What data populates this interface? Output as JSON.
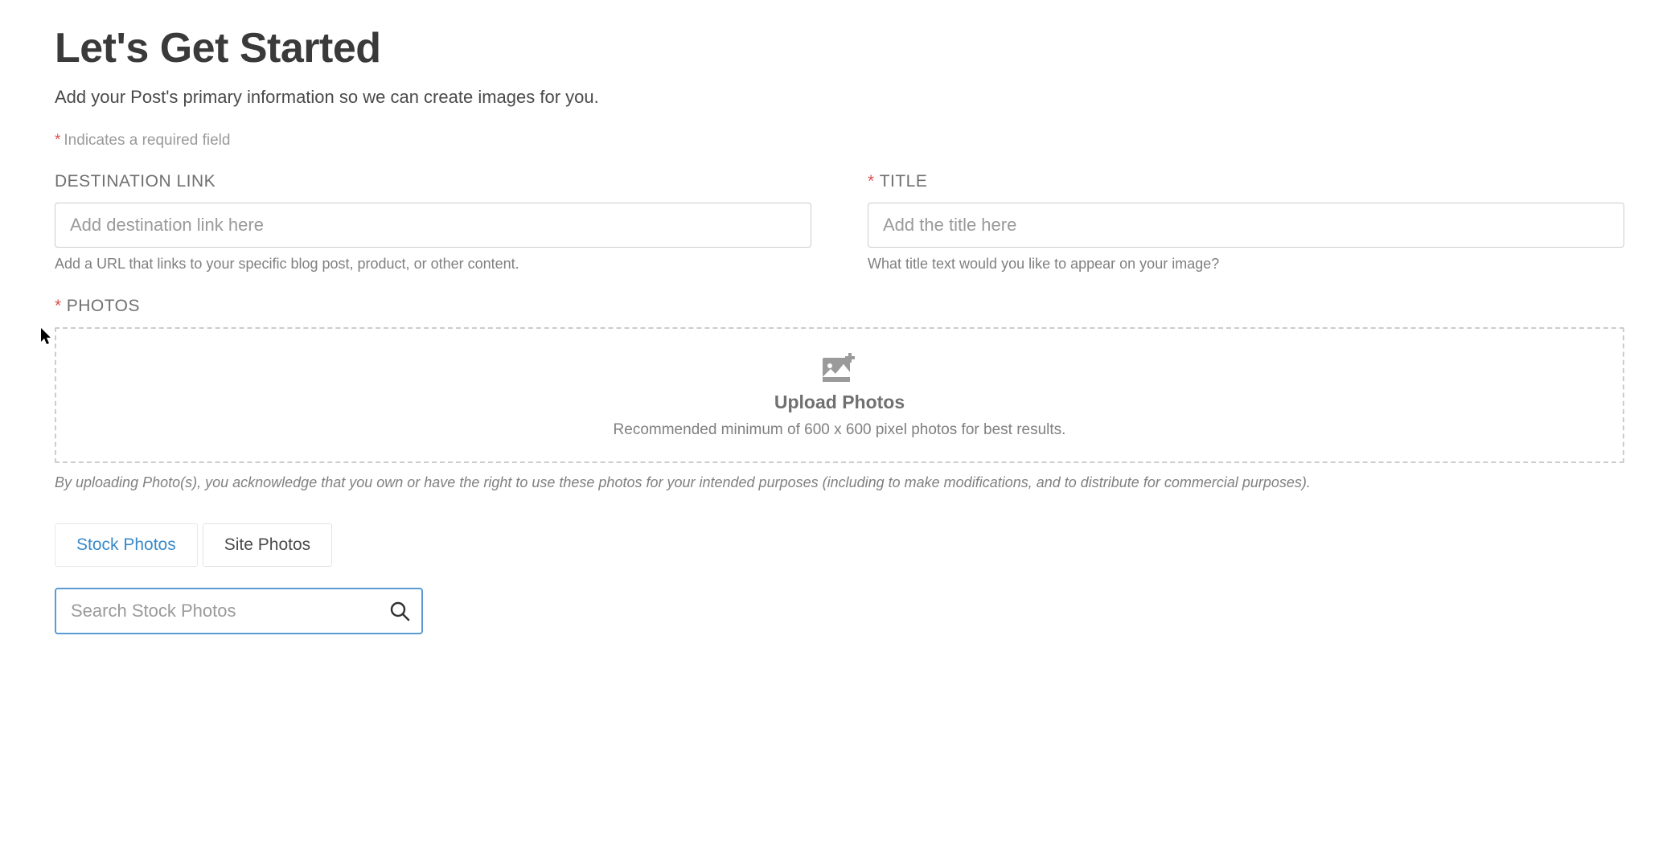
{
  "header": {
    "title": "Let's Get Started",
    "subtitle": "Add your Post's primary information so we can create images for you."
  },
  "required_note": {
    "asterisk": "*",
    "text": "Indicates a required field"
  },
  "fields": {
    "destination": {
      "label": "DESTINATION LINK",
      "placeholder": "Add destination link here",
      "help": "Add a URL that links to your specific blog post, product, or other content."
    },
    "title": {
      "asterisk": "*",
      "label": "TITLE",
      "placeholder": "Add the title here",
      "help": "What title text would you like to appear on your image?"
    }
  },
  "photos": {
    "asterisk": "*",
    "label": "PHOTOS",
    "upload_title": "Upload Photos",
    "upload_help": "Recommended minimum of 600 x 600 pixel photos for best results.",
    "disclaimer": "By uploading Photo(s), you acknowledge that you own or have the right to use these photos for your intended purposes (including to make modifications, and to distribute for commercial purposes)."
  },
  "tabs": {
    "stock": "Stock Photos",
    "site": "Site Photos"
  },
  "search": {
    "placeholder": "Search Stock Photos"
  }
}
